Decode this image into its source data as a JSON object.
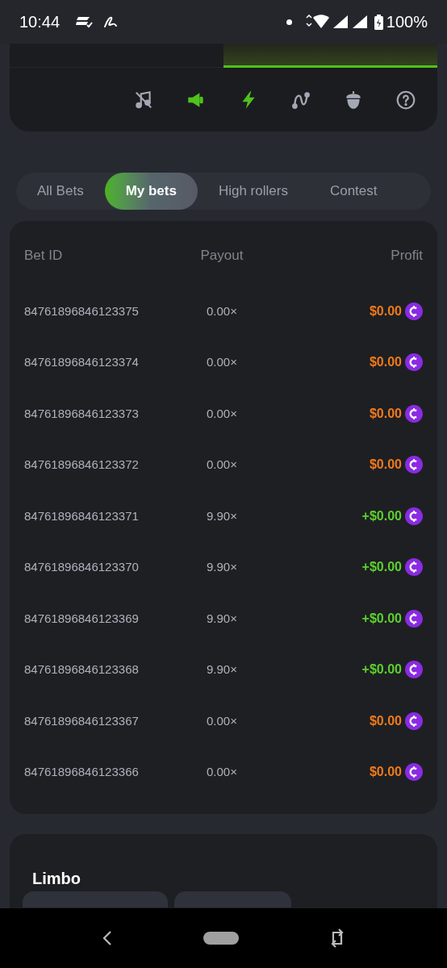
{
  "status_bar": {
    "time": "10:44",
    "battery": "100%"
  },
  "mode_tabs": [
    {
      "selected": false
    },
    {
      "selected": true
    }
  ],
  "tools": [
    {
      "kind": "music-off",
      "on": false
    },
    {
      "kind": "megaphone",
      "on": true
    },
    {
      "kind": "lightning",
      "on": true
    },
    {
      "kind": "curve",
      "on": false
    },
    {
      "kind": "acorn",
      "on": false
    },
    {
      "kind": "help",
      "on": false
    }
  ],
  "bet_tabs": [
    {
      "label": "All Bets",
      "selected": false
    },
    {
      "label": "My bets",
      "selected": true
    },
    {
      "label": "High rollers",
      "selected": false
    },
    {
      "label": "Contest",
      "selected": false
    }
  ],
  "table": {
    "columns": [
      "Bet ID",
      "Payout",
      "Profit"
    ],
    "rows": [
      {
        "bet_id": "84761896846123375",
        "payout": "0.00×",
        "profit": "$0.00",
        "kind": "loss"
      },
      {
        "bet_id": "84761896846123374",
        "payout": "0.00×",
        "profit": "$0.00",
        "kind": "loss"
      },
      {
        "bet_id": "84761896846123373",
        "payout": "0.00×",
        "profit": "$0.00",
        "kind": "loss"
      },
      {
        "bet_id": "84761896846123372",
        "payout": "0.00×",
        "profit": "$0.00",
        "kind": "loss"
      },
      {
        "bet_id": "84761896846123371",
        "payout": "9.90×",
        "profit": "+$0.00",
        "kind": "win"
      },
      {
        "bet_id": "84761896846123370",
        "payout": "9.90×",
        "profit": "+$0.00",
        "kind": "win"
      },
      {
        "bet_id": "84761896846123369",
        "payout": "9.90×",
        "profit": "+$0.00",
        "kind": "win"
      },
      {
        "bet_id": "84761896846123368",
        "payout": "9.90×",
        "profit": "+$0.00",
        "kind": "win"
      },
      {
        "bet_id": "84761896846123367",
        "payout": "0.00×",
        "profit": "$0.00",
        "kind": "loss"
      },
      {
        "bet_id": "84761896846123366",
        "payout": "0.00×",
        "profit": "$0.00",
        "kind": "loss"
      }
    ]
  },
  "game": {
    "title": "Limbo"
  }
}
